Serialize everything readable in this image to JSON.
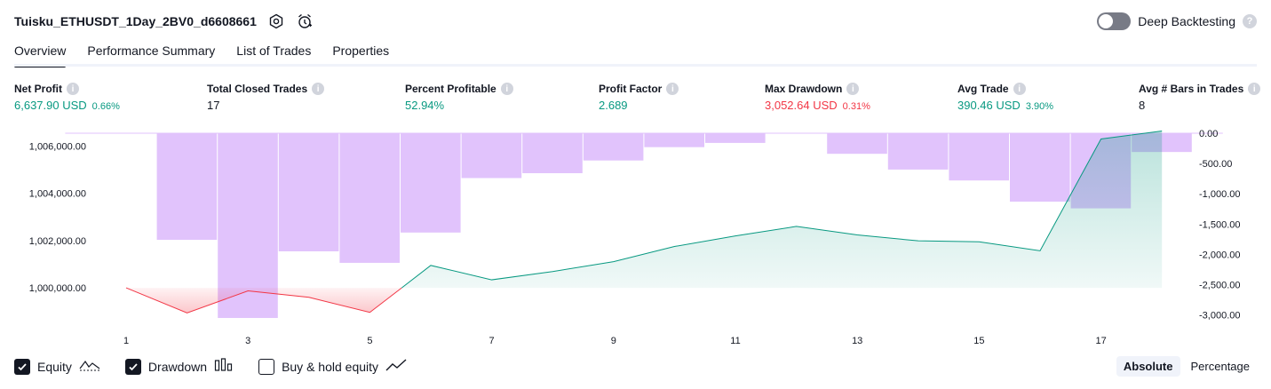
{
  "header": {
    "title": "Tuisku_ETHUSDT_1Day_2BV0_d6608661",
    "deep_backtesting_label": "Deep Backtesting",
    "deep_backtesting_enabled": false,
    "help_glyph": "?"
  },
  "tabs": [
    {
      "label": "Overview",
      "active": true
    },
    {
      "label": "Performance Summary",
      "active": false
    },
    {
      "label": "List of Trades",
      "active": false
    },
    {
      "label": "Properties",
      "active": false
    }
  ],
  "info_glyph": "i",
  "metrics": [
    {
      "label": "Net Profit",
      "value": "6,637.90 USD",
      "pct": "0.66%",
      "color": "green"
    },
    {
      "label": "Total Closed Trades",
      "value": "17",
      "pct": "",
      "color": "dark"
    },
    {
      "label": "Percent Profitable",
      "value": "52.94%",
      "pct": "",
      "color": "green"
    },
    {
      "label": "Profit Factor",
      "value": "2.689",
      "pct": "",
      "color": "green"
    },
    {
      "label": "Max Drawdown",
      "value": "3,052.64 USD",
      "pct": "0.31%",
      "color": "red"
    },
    {
      "label": "Avg Trade",
      "value": "390.46 USD",
      "pct": "3.90%",
      "color": "green"
    },
    {
      "label": "Avg # Bars in Trades",
      "value": "8",
      "pct": "",
      "color": "dark"
    }
  ],
  "chart_data": {
    "type": "area",
    "left_axis": {
      "ticks": [
        "1,006,000.00",
        "1,004,000.00",
        "1,002,000.00",
        "1,000,000.00"
      ],
      "values": [
        1006000,
        1004000,
        1002000,
        1000000
      ]
    },
    "right_axis": {
      "ticks": [
        "0.00",
        "-500.00",
        "-1,000.00",
        "-1,500.00",
        "-2,000.00",
        "-2,500.00",
        "-3,000.00"
      ],
      "values": [
        0,
        -500,
        -1000,
        -1500,
        -2000,
        -2500,
        -3000
      ]
    },
    "x_ticks": [
      "1",
      "3",
      "5",
      "7",
      "9",
      "11",
      "13",
      "15",
      "17"
    ],
    "equity": {
      "x": [
        1,
        2,
        3,
        4,
        5,
        6,
        7,
        8,
        9,
        10,
        11,
        12,
        13,
        14,
        15,
        16,
        17,
        18
      ],
      "y": [
        1000000,
        998940,
        999870,
        999600,
        998960,
        1000950,
        1000340,
        1000690,
        1001110,
        1001750,
        1002200,
        1002600,
        1002240,
        1001990,
        1001950,
        1001570,
        1006300,
        1006640
      ],
      "baseline": 1000000,
      "color_above": "#089981",
      "color_below": "#f23645"
    },
    "drawdown": {
      "x": [
        1,
        2,
        3,
        4,
        5,
        6,
        7,
        8,
        9,
        10,
        11,
        12,
        13,
        14,
        15,
        16,
        17,
        18
      ],
      "y": [
        0,
        -1760,
        -3050,
        -1950,
        -2140,
        -1640,
        -740,
        -660,
        -450,
        -230,
        -160,
        0,
        -340,
        -600,
        -780,
        -1130,
        -1240,
        -310
      ],
      "color": "#e1c3fc"
    }
  },
  "legend": [
    {
      "label": "Equity",
      "checked": true,
      "icon": "equity-line-icon"
    },
    {
      "label": "Drawdown",
      "checked": true,
      "icon": "drawdown-bars-icon"
    },
    {
      "label": "Buy & hold equity",
      "checked": false,
      "icon": "buy-hold-line-icon"
    }
  ],
  "mode": {
    "absolute": "Absolute",
    "percentage": "Percentage",
    "selected": "Absolute"
  }
}
